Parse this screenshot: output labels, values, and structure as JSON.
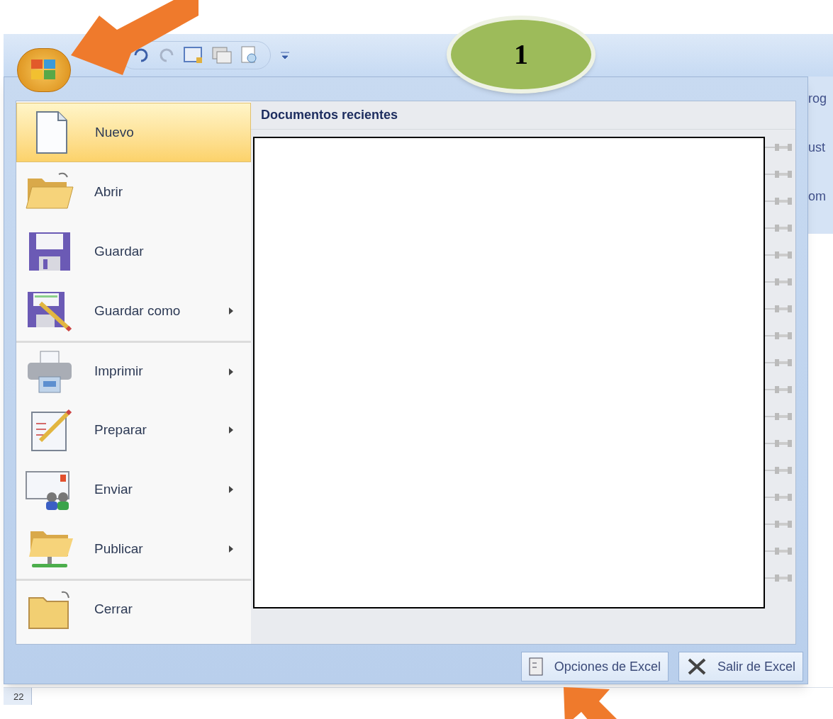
{
  "badge": {
    "label": "1"
  },
  "menu": {
    "items": [
      {
        "label": "Nuevo",
        "selected": true,
        "submenu": false,
        "separator_before": false
      },
      {
        "label": "Abrir",
        "selected": false,
        "submenu": false,
        "separator_before": false
      },
      {
        "label": "Guardar",
        "selected": false,
        "submenu": false,
        "separator_before": false
      },
      {
        "label": "Guardar como",
        "selected": false,
        "submenu": true,
        "separator_before": false
      },
      {
        "label": "Imprimir",
        "selected": false,
        "submenu": true,
        "separator_before": true
      },
      {
        "label": "Preparar",
        "selected": false,
        "submenu": true,
        "separator_before": false
      },
      {
        "label": "Enviar",
        "selected": false,
        "submenu": true,
        "separator_before": false
      },
      {
        "label": "Publicar",
        "selected": false,
        "submenu": true,
        "separator_before": false
      },
      {
        "label": "Cerrar",
        "selected": false,
        "submenu": false,
        "separator_before": true
      }
    ],
    "recent": {
      "title": "Documentos recientes"
    },
    "footer_buttons": [
      {
        "label": "Opciones de Excel"
      },
      {
        "label": "Salir de Excel"
      }
    ]
  },
  "ribbon_fragments": [
    "rog",
    "ust",
    "om"
  ],
  "row_headers": [
    "22"
  ]
}
